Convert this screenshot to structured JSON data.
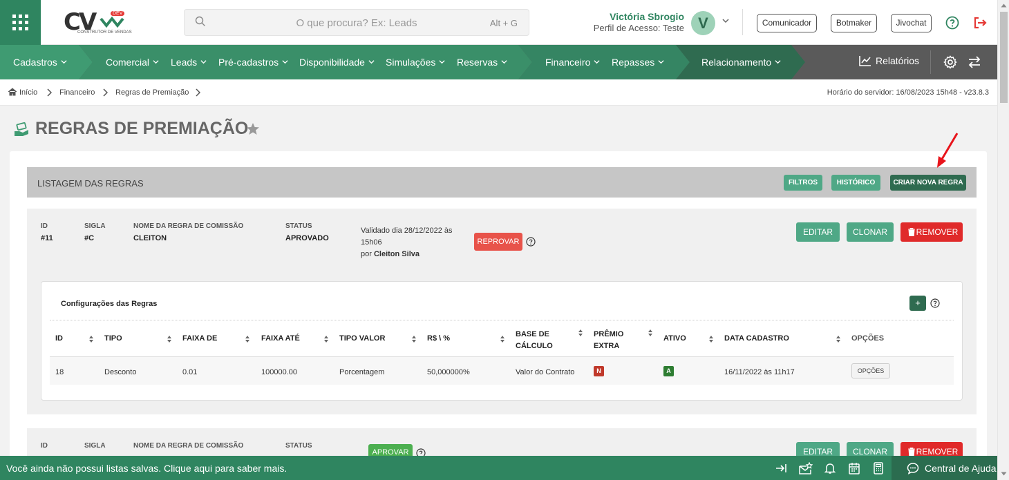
{
  "header": {
    "logo_text": "CV",
    "logo_sub": "CONSTRUTOR DE VENDAS",
    "logo_badge": "DEV",
    "search_placeholder": "O que procura? Ex: Leads",
    "search_shortcut": "Alt + G",
    "user_name": "Victória Sbrogio",
    "user_profile": "Perfil de Acesso: Teste",
    "avatar_letter": "V",
    "buttons": [
      "Comunicador",
      "Botmaker",
      "Jivochat"
    ]
  },
  "nav": {
    "items": [
      "Cadastros",
      "Comercial",
      "Leads",
      "Pré-cadastros",
      "Disponibilidade",
      "Simulações",
      "Reservas",
      "Financeiro",
      "Repasses",
      "Relacionamento"
    ],
    "reports": "Relatórios",
    "colors": {
      "primary": "#3f9b72",
      "dark": "#2f6b50",
      "gray": "#5a5a5a"
    }
  },
  "breadcrumb": [
    "Início",
    "Financeiro",
    "Regras de Premiação"
  ],
  "server_time": "Horário do servidor: 16/08/2023 15h48 - v23.8.3",
  "page_title": "REGRAS DE PREMIAÇÃO",
  "list": {
    "title": "LISTAGEM DAS REGRAS",
    "buttons": {
      "filters": "FILTROS",
      "history": "HISTÓRICO",
      "create": "CRIAR NOVA REGRA"
    }
  },
  "labels": {
    "id": "ID",
    "sigla": "SIGLA",
    "nome": "NOME DA REGRA DE COMISSÃO",
    "status": "STATUS"
  },
  "actions": {
    "edit": "EDITAR",
    "clone": "CLONAR",
    "remove": "REMOVER"
  },
  "rules": [
    {
      "id": "#11",
      "sigla": "#C",
      "nome": "CLEITON",
      "status": "APROVADO",
      "validated_line1": "Validado dia 28/12/2022 às",
      "validated_line2": "15h06",
      "validated_by_prefix": "por",
      "validated_by": "Cleiton Silva",
      "status_action": "REPROVAR",
      "config": {
        "title": "Configurações das Regras",
        "add": "+",
        "headers": [
          "ID",
          "TIPO",
          "FAIXA DE",
          "FAIXA ATÉ",
          "TIPO VALOR",
          "R$ \\ %",
          "BASE DE CÁLCULO",
          "PRÊMIO EXTRA",
          "ATIVO",
          "DATA CADASTRO",
          "OPÇÕES"
        ],
        "rows": [
          {
            "id": "18",
            "tipo": "Desconto",
            "faixa_de": "0.01",
            "faixa_ate": "100000.00",
            "tipo_valor": "Porcentagem",
            "valor": "50,000000%",
            "base": "Valor do Contrato",
            "premio_extra": "N",
            "ativo": "A",
            "data": "16/11/2022 às 11h17",
            "opcoes": "OPÇÕES"
          }
        ]
      }
    },
    {
      "status_action": "APROVAR"
    }
  ],
  "bottom": {
    "message": "Você ainda não possui listas salvas. Clique aqui para saber mais.",
    "help_center": "Central de Ajuda"
  }
}
